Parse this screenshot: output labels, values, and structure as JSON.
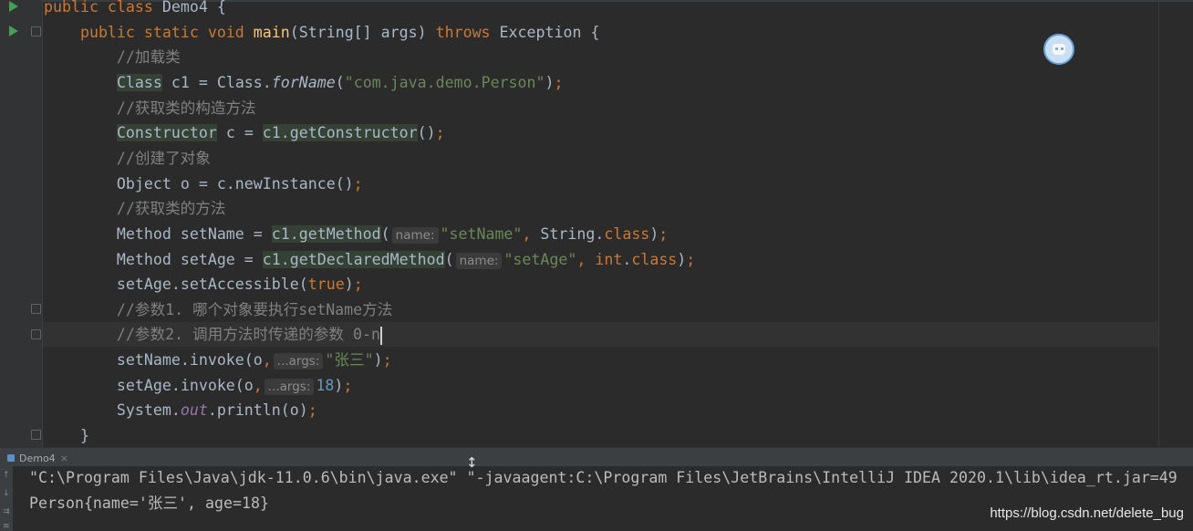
{
  "editor": {
    "lines": [
      [
        {
          "t": "public class ",
          "c": "kw"
        },
        {
          "t": "Demo4 {"
        }
      ],
      [
        {
          "t": "    public static void ",
          "c": "kw"
        },
        {
          "t": "main",
          "c": "fn"
        },
        {
          "t": "(String[] args) "
        },
        {
          "t": "throws ",
          "c": "kw"
        },
        {
          "t": "Exception {"
        }
      ],
      [
        {
          "t": "        //加载类",
          "c": "cm"
        }
      ],
      [
        {
          "t": "        "
        },
        {
          "t": "Class",
          "c": "hl"
        },
        {
          "t": " c1 = Class."
        },
        {
          "t": "forName",
          "c": "it"
        },
        {
          "t": "("
        },
        {
          "t": "\"com.java.demo.Person\"",
          "c": "st"
        },
        {
          "t": ")"
        },
        {
          "t": ";",
          "c": "kw"
        }
      ],
      [
        {
          "t": "        //获取类的构造方法",
          "c": "cm"
        }
      ],
      [
        {
          "t": "        "
        },
        {
          "t": "Constructor",
          "c": "hl"
        },
        {
          "t": " c = "
        },
        {
          "t": "c1.getConstructor",
          "c": "hl"
        },
        {
          "t": "()"
        },
        {
          "t": ";",
          "c": "kw"
        }
      ],
      [
        {
          "t": "        //创建了对象",
          "c": "cm"
        }
      ],
      [
        {
          "t": "        Object o = c.newInstance()"
        },
        {
          "t": ";",
          "c": "kw"
        }
      ],
      [
        {
          "t": "        //获取类的方法",
          "c": "cm"
        }
      ],
      [
        {
          "t": "        Method setName = "
        },
        {
          "t": "c1.getMethod",
          "c": "hl"
        },
        {
          "t": "("
        },
        {
          "t": "name:",
          "c": "hint"
        },
        {
          "t": "\"setName\"",
          "c": "st"
        },
        {
          "t": ", ",
          "c": "kw"
        },
        {
          "t": "String."
        },
        {
          "t": "class",
          "c": "kw"
        },
        {
          "t": ")"
        },
        {
          "t": ";",
          "c": "kw"
        }
      ],
      [
        {
          "t": "        Method setAge = "
        },
        {
          "t": "c1.getDeclaredMethod",
          "c": "hl"
        },
        {
          "t": "("
        },
        {
          "t": "name:",
          "c": "hint"
        },
        {
          "t": "\"setAge\"",
          "c": "st"
        },
        {
          "t": ", ",
          "c": "kw"
        },
        {
          "t": "int",
          "c": "kw"
        },
        {
          "t": "."
        },
        {
          "t": "class",
          "c": "kw"
        },
        {
          "t": ")"
        },
        {
          "t": ";",
          "c": "kw"
        }
      ],
      [
        {
          "t": "        setAge.setAccessible("
        },
        {
          "t": "true",
          "c": "kw"
        },
        {
          "t": ")"
        },
        {
          "t": ";",
          "c": "kw"
        }
      ],
      [
        {
          "t": "        //参数1. 哪个对象要执行setName方法",
          "c": "cm"
        }
      ],
      [
        {
          "t": "        //参数2. 调用方法时传递的参数 0-n",
          "c": "cm"
        },
        {
          "t": "",
          "c": "caret"
        }
      ],
      [
        {
          "t": "        setName.invoke(o"
        },
        {
          "t": ",",
          "c": "kw"
        },
        {
          "t": "...args:",
          "c": "hint"
        },
        {
          "t": "\"张三\"",
          "c": "st"
        },
        {
          "t": ")"
        },
        {
          "t": ";",
          "c": "kw"
        }
      ],
      [
        {
          "t": "        setAge.invoke(o"
        },
        {
          "t": ",",
          "c": "kw"
        },
        {
          "t": "...args:",
          "c": "hint"
        },
        {
          "t": "18",
          "c": "nm"
        },
        {
          "t": ")"
        },
        {
          "t": ";",
          "c": "kw"
        }
      ],
      [
        {
          "t": "        System."
        },
        {
          "t": "out",
          "c": "fld"
        },
        {
          "t": ".println(o)"
        },
        {
          "t": ";",
          "c": "kw"
        }
      ],
      [
        {
          "t": "    }"
        }
      ]
    ]
  },
  "run_panel": {
    "tab_label": "Demo4",
    "tab_close": "×",
    "output": [
      "\"C:\\Program Files\\Java\\jdk-11.0.6\\bin\\java.exe\" \"-javaagent:C:\\Program Files\\JetBrains\\IntelliJ IDEA 2020.1\\lib\\idea_rt.jar=49",
      "Person{name='张三', age=18}"
    ]
  },
  "watermark": "https://blog.csdn.net/delete_bug",
  "colors": {
    "keyword": "#cc7832",
    "comment": "#808080",
    "string": "#6a8759",
    "number": "#6897bb",
    "method_decl": "#ffc66d",
    "default": "#a9b7c6"
  }
}
